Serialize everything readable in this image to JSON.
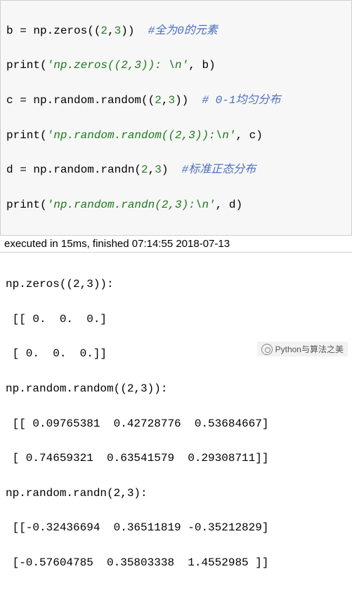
{
  "code": {
    "l1": {
      "a": "b = np.zeros((",
      "n1": "2",
      "m": ",",
      "n2": "3",
      "b": "))  ",
      "c": "#全为0的元素"
    },
    "l2": {
      "a": "print(",
      "s": "'np.zeros((2,3)): \\n'",
      "b": ", b)"
    },
    "l3": {
      "a": "c = np.random.random((",
      "n1": "2",
      "m": ",",
      "n2": "3",
      "b": "))  ",
      "c": "# 0-1均匀分布"
    },
    "l4": {
      "a": "print(",
      "s": "'np.random.random((2,3)):\\n'",
      "b": ", c)"
    },
    "l5": {
      "a": "d = np.random.randn(",
      "n1": "2",
      "m": ",",
      "n2": "3",
      "b": ")  ",
      "c": "#标准正态分布"
    },
    "l6": {
      "a": "print(",
      "s": "'np.random.randn(2,3):\\n'",
      "b": ", d)"
    }
  },
  "exec": "executed in 15ms, finished 07:14:55 2018-07-13",
  "output": {
    "o1": "np.zeros((2,3)):",
    "o2": " [[ 0.  0.  0.]",
    "o3": " [ 0.  0.  0.]]",
    "o4": "np.random.random((2,3)):",
    "o5": " [[ 0.09765381  0.42728776  0.53684667]",
    "o6": " [ 0.74659321  0.63541579  0.29308711]]",
    "o7": "np.random.randn(2,3):",
    "o8": " [[-0.32436694  0.36511819 -0.35212829]",
    "o9": " [-0.57604785  0.35803338  1.4552985 ]]"
  },
  "watermark": "Python与算法之美"
}
